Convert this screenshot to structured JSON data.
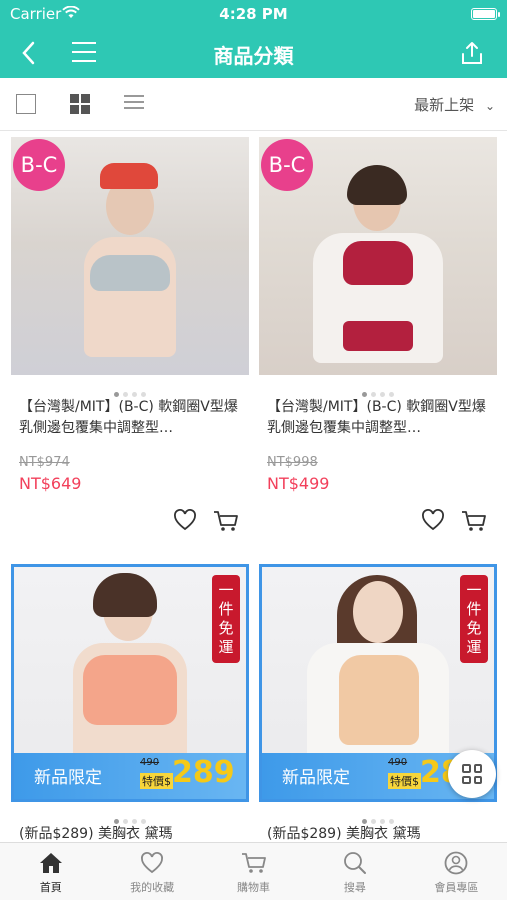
{
  "status_bar": {
    "carrier": "Carrier",
    "time": "4:28 PM"
  },
  "navbar": {
    "title": "商品分類",
    "back_icon": "chevron-left-icon",
    "menu_icon": "hamburger-icon",
    "share_icon": "share-icon"
  },
  "toolbar": {
    "sort_label": "最新上架"
  },
  "products": [
    {
      "badge": "B-C",
      "name": "【台灣製/MIT】(B-C) 軟鋼圈V型爆乳側邊包覆集中調整型…",
      "original_price": "NT$974",
      "price": "NT$649"
    },
    {
      "badge": "B-C",
      "name": "【台灣製/MIT】(B-C) 軟鋼圈V型爆乳側邊包覆集中調整型…",
      "original_price": "NT$998",
      "price": "NT$499"
    },
    {
      "name": "(新品$289) 美胸衣  黛瑪",
      "promo_label": "新品限定",
      "promo_old": "490",
      "promo_special": "特價$",
      "promo_price": "289",
      "corner_text": "一件免運"
    },
    {
      "name": "(新品$289) 美胸衣  黛瑪",
      "promo_label": "新品限定",
      "promo_old": "490",
      "promo_special": "特價$",
      "promo_price": "28",
      "corner_text": "一件免運"
    }
  ],
  "tabbar": [
    {
      "label": "首頁",
      "icon": "home-icon"
    },
    {
      "label": "我的收藏",
      "icon": "heart-icon"
    },
    {
      "label": "購物車",
      "icon": "cart-icon"
    },
    {
      "label": "搜尋",
      "icon": "search-icon"
    },
    {
      "label": "會員專區",
      "icon": "user-icon"
    }
  ],
  "colors": {
    "brand": "#2ec8b4",
    "price": "#f2405b",
    "badge": "#e8408c",
    "promo": "#3e9ae9"
  }
}
